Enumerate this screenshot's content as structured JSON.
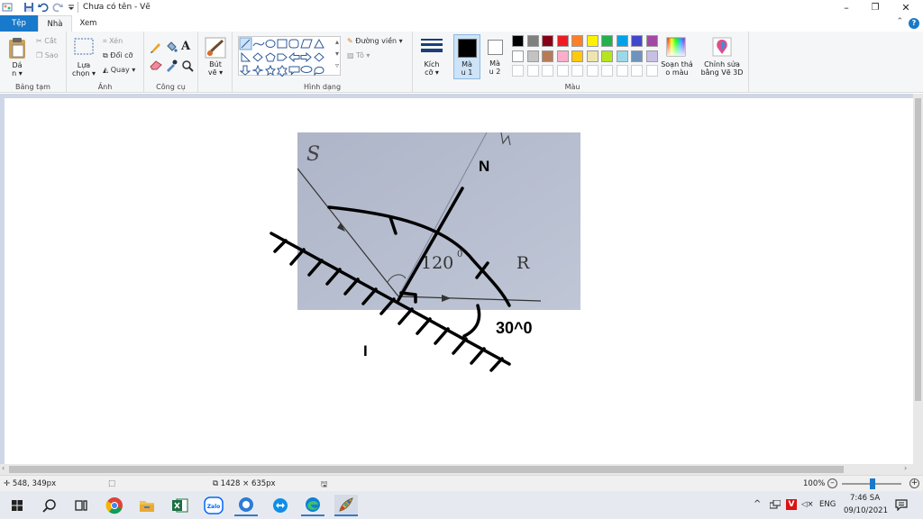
{
  "window": {
    "title": "Chưa có tên - Vẽ",
    "minimize": "–",
    "maximize": "❐",
    "close": "✕"
  },
  "tabs": {
    "file": "Tệp",
    "home": "Nhà",
    "view": "Xem",
    "help": "?"
  },
  "ribbon": {
    "clipboard": {
      "paste": "Dá\nn ▾",
      "cut": "Cắt",
      "copy": "Sao",
      "label": "Bảng tạm"
    },
    "image": {
      "select": "Lựa\nchọn ▾",
      "crop": "Xén",
      "resize": "Đổi cỡ",
      "rotate": "Quay ▾",
      "label": "Ảnh"
    },
    "tools": {
      "label": "Công cụ",
      "text_tool": "A"
    },
    "brush": {
      "label": "Bút\nvẽ ▾"
    },
    "shapes": {
      "outline": "Đường viền ▾",
      "fill": "Tô ▾",
      "label": "Hình dạng"
    },
    "size": {
      "label": "Kích\ncỡ ▾"
    },
    "color1": {
      "label": "Mà\nu 1",
      "value": "#000000"
    },
    "color2": {
      "label": "Mà\nu 2",
      "value": "#ffffff"
    },
    "colors": {
      "label": "Màu",
      "row1": [
        "#000000",
        "#7f7f7f",
        "#880015",
        "#ed1c24",
        "#ff7f27",
        "#fff200",
        "#22b14c",
        "#00a2e8",
        "#3f48cc",
        "#a349a4"
      ],
      "row2": [
        "#ffffff",
        "#c3c3c3",
        "#b97a57",
        "#ffaec9",
        "#ffc90e",
        "#efe4b0",
        "#b5e61d",
        "#99d9ea",
        "#7092be",
        "#c8bfe7"
      ],
      "row3": [
        "#ffffff",
        "#ffffff",
        "#ffffff",
        "#ffffff",
        "#ffffff",
        "#ffffff",
        "#ffffff",
        "#ffffff",
        "#ffffff",
        "#ffffff"
      ]
    },
    "edit_colors": "Soạn thả\no màu",
    "paint3d": "Chỉnh sửa\nbằng Vẽ 3D"
  },
  "drawing": {
    "photo_labels": {
      "s": "S",
      "angle": "120",
      "r": "R",
      "n_top": "N"
    },
    "ink_labels": {
      "n": "N",
      "angle30": "30^0",
      "i": "I"
    }
  },
  "status": {
    "cursor_pos": "548, 349px",
    "canvas_size": "1428 × 635px",
    "zoom": "100%"
  },
  "taskbar": {
    "lang": "ENG",
    "time": "7:46 SA",
    "date": "09/10/2021"
  }
}
